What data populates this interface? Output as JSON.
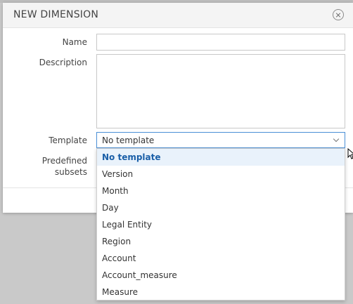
{
  "dialog": {
    "title": "NEW DIMENSION",
    "close_icon": "close-circle-icon"
  },
  "form": {
    "name_label": "Name",
    "name_value": "",
    "description_label": "Description",
    "description_value": "",
    "template_label": "Template",
    "template_value": "No template",
    "predefined_label_line1": "Predefined",
    "predefined_label_line2": "subsets"
  },
  "dropdown": {
    "options": [
      "No template",
      "Version",
      "Month",
      "Day",
      "Legal Entity",
      "Region",
      "Account",
      "Account_measure",
      "Measure"
    ],
    "selected": "No template"
  },
  "colors": {
    "accent": "#4a8fd6",
    "selected_text": "#1a5fa8",
    "selected_bg": "#e9f2fb"
  }
}
